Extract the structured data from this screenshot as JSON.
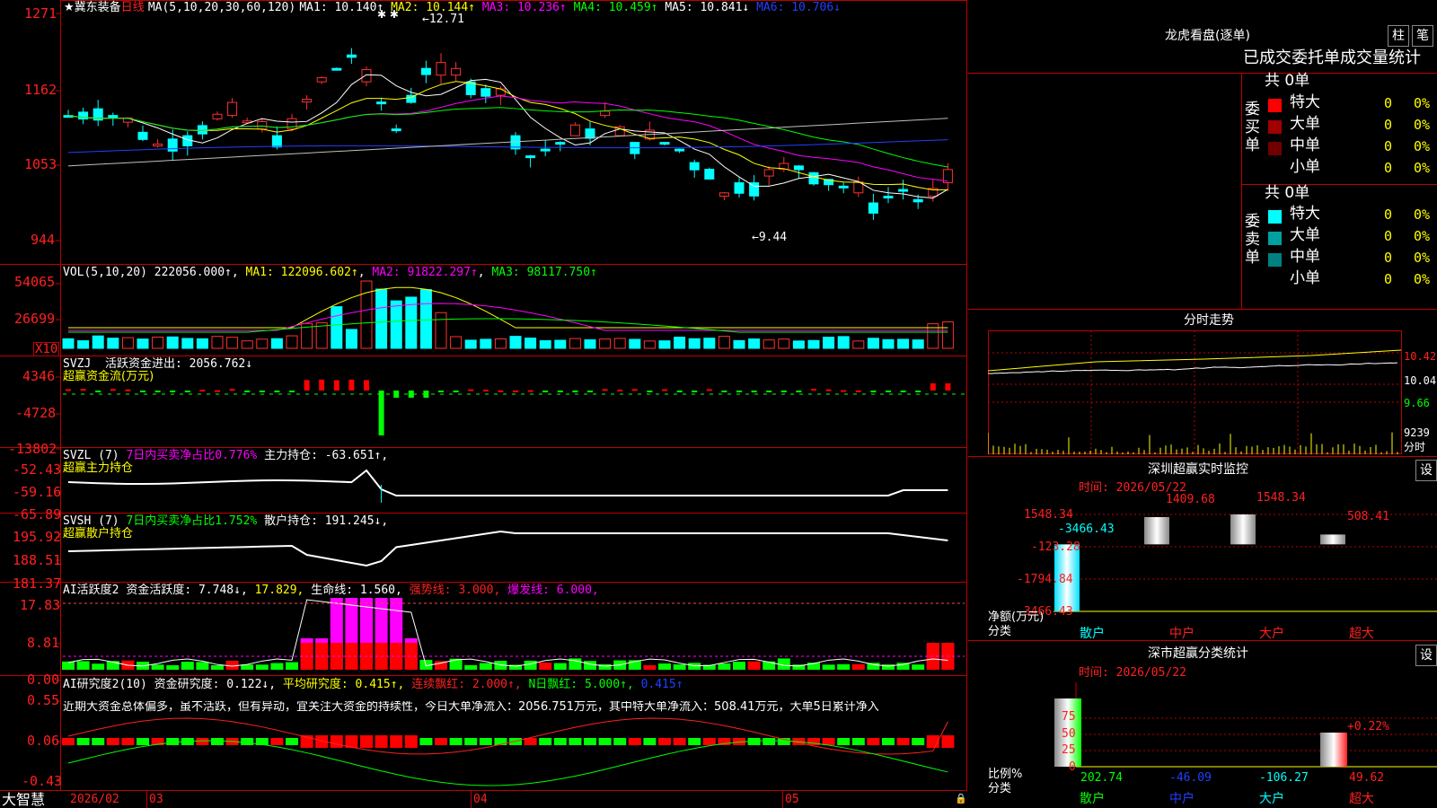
{
  "stock": {
    "name": "冀东装备",
    "period": "日线"
  },
  "main": {
    "ma_title": "MA(5,10,20,30,60,120)",
    "ma": [
      {
        "label": "MA1: 10.140↑",
        "color": "#ffffff"
      },
      {
        "label": "MA2: 10.144↑",
        "color": "#ffff00"
      },
      {
        "label": "MA3: 10.236↑",
        "color": "#ff00ff"
      },
      {
        "label": "MA4: 10.459↑",
        "color": "#00ff00"
      },
      {
        "label": "MA5: 10.841↓",
        "color": "#ffffff"
      },
      {
        "label": "MA6: 10.706↓",
        "color": "#2040ff"
      }
    ],
    "y_ticks": [
      "1271",
      "1162",
      "1053",
      "944"
    ],
    "high_label": "12.71",
    "low_label": "9.44"
  },
  "vol": {
    "title": "VOL(5,10,20)",
    "value": "222056.000↑",
    "ma1": "MA1: 122096.602↑",
    "ma2": "MA2: 91822.297↑",
    "ma3": "MA3: 98117.750↑",
    "y_ticks": [
      "54065",
      "26699"
    ],
    "unit": "X10"
  },
  "svzj": {
    "title": "SVZJ",
    "label": "活跃资金进出: 2056.762↓",
    "subtitle": "超赢资金流(万元)",
    "y_ticks": [
      "4346",
      "-4728",
      "-13802"
    ]
  },
  "svzl": {
    "title": "SVZL (7)",
    "ratio": "7日内买卖净占比0.776%",
    "hold": "主力持仓: -63.651↑,",
    "subtitle": "超赢主力持仓",
    "y_ticks": [
      "-52.43",
      "-59.16",
      "-65.89"
    ]
  },
  "svsh": {
    "title": "SVSH (7)",
    "ratio": "7日内买卖净占比1.752%",
    "hold": "散户持仓: 191.245↓,",
    "subtitle": "超赢散户持仓",
    "y_ticks": [
      "195.92",
      "188.51",
      "181.37"
    ]
  },
  "ai_active": {
    "title": "AI活跃度2",
    "a": "资金活跃度: 7.748↓",
    "b": "17.829,",
    "c": "生命线: 1.560,",
    "d": "强势线: 3.000,",
    "e": "爆发线: 6.000,",
    "y_ticks": [
      "17.83",
      "8.81",
      "0.00"
    ]
  },
  "ai_research": {
    "title": "AI研究度2(10)",
    "a": "资金研究度: 0.122↓,",
    "b": "平均研究度: 0.415↑,",
    "c": "连续飘红: 2.000↑,",
    "d": "N日飘红: 5.000↑,",
    "e": "0.415↑",
    "comment": "近期大资金总体偏多，虽不活跃，但有异动，宜关注大资金的持续性，今日大单净流入：2056.751万元，其中特大单净流入：508.41万元，大单5日累计净入",
    "y_ticks": [
      "0.55",
      "0.06",
      "-0.43"
    ]
  },
  "axis": {
    "brand": "大智慧",
    "dates": [
      "2026/02",
      "03",
      "04",
      "05"
    ]
  },
  "dragon": {
    "title": "龙虎看盘(逐单)",
    "btn1": "柱",
    "btn2": "笔",
    "header": "已成交委托单成交量统计",
    "buy": {
      "side": "委买单",
      "total": "共 0单",
      "rows": [
        {
          "label": "特大",
          "count": "0",
          "pct": "0%",
          "color": "#ff0000"
        },
        {
          "label": "大单",
          "count": "0",
          "pct": "0%",
          "color": "#a00000"
        },
        {
          "label": "中单",
          "count": "0",
          "pct": "0%",
          "color": "#700000"
        },
        {
          "label": "小单",
          "count": "0",
          "pct": "0%",
          "color": "#000000"
        }
      ]
    },
    "sell": {
      "side": "委卖单",
      "total": "共 0单",
      "rows": [
        {
          "label": "特大",
          "count": "0",
          "pct": "0%",
          "color": "#00ffff"
        },
        {
          "label": "大单",
          "count": "0",
          "pct": "0%",
          "color": "#00a0a0"
        },
        {
          "label": "中单",
          "count": "0",
          "pct": "0%",
          "color": "#008080"
        },
        {
          "label": "小单",
          "count": "0",
          "pct": "0%",
          "color": "#000000"
        }
      ]
    }
  },
  "intraday": {
    "title": "分时走势",
    "ticks": [
      "10.42",
      "10.04",
      "9.66"
    ],
    "vol": "9239",
    "vol_label": "分时"
  },
  "sz_monitor": {
    "title": "深圳超赢实时监控",
    "btn": "设",
    "time": "时间: 2026/05/22",
    "y_ticks": [
      "1548.34",
      "-123.28",
      "-1794.84",
      "-3466.43"
    ],
    "values": [
      {
        "cat": "散户",
        "val": "-3466.43"
      },
      {
        "cat": "中户",
        "val": "1409.68"
      },
      {
        "cat": "大户",
        "val": "1548.34"
      },
      {
        "cat": "超大",
        "val": "508.41"
      }
    ],
    "ylabel": "净额(万元)",
    "xlabel": "分类"
  },
  "sz_class": {
    "title": "深市超赢分类统计",
    "btn": "设",
    "time": "时间: 2026/05/22",
    "y_ticks": [
      "75",
      "50",
      "25",
      "0"
    ],
    "top_label": "+0.22%",
    "values": [
      {
        "cat": "散户",
        "val": "202.74"
      },
      {
        "cat": "中户",
        "val": "-46.09"
      },
      {
        "cat": "大户",
        "val": "-106.27"
      },
      {
        "cat": "超大",
        "val": "49.62"
      }
    ],
    "ylabel": "比例%",
    "xlabel": "分类"
  }
}
